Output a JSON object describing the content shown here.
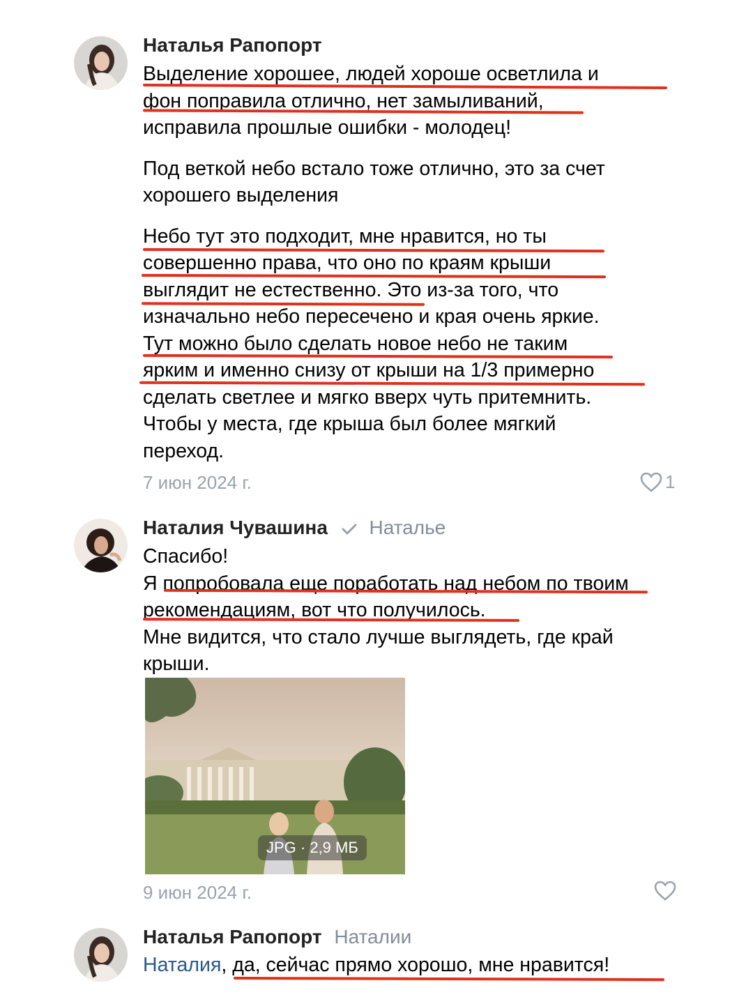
{
  "comments": [
    {
      "author": "Наталья Рапопорт",
      "lines": [
        "Выделение хорошее, людей хороше осветлила и",
        "фон поправила отлично, нет замыливаний,",
        "исправила прошлые ошибки - молодец!"
      ],
      "paragraph2": [
        "Под веткой небо встало тоже отлично, это за счет",
        "хорошего выделения"
      ],
      "paragraph3": [
        "Небо тут это подходит, мне нравится, но ты",
        "совершенно права, что оно по краям крыши",
        "выглядит не естественно. Это из-за того, что",
        "изначально небо пересечено и края очень яркие.",
        "Тут можно было сделать новое небо не таким",
        "ярким и именно снизу от крыши на 1/3 примерно",
        "сделать светлее и мягко вверх чуть притемнить.",
        "Чтобы у места, где крыша был более мягкий",
        "переход."
      ],
      "date": "7 июн 2024 г.",
      "likes": "1"
    },
    {
      "author": "Наталия Чувашина",
      "reply_to": "Наталье",
      "lines": [
        "Спасибо!",
        "Я попробовала еще поработать над небом по твоим",
        "рекомендациям, вот что получилось.",
        "Мне видится, что стало лучше выглядеть, где край",
        "крыши."
      ],
      "attachment": {
        "label": "JPG · 2,9 МБ"
      },
      "date": "9 июн 2024 г."
    },
    {
      "author": "Наталья Рапопорт",
      "reply_to": "Наталии",
      "mention": "Наталия",
      "text": ", да, сейчас прямо хорошо, мне нравится!"
    }
  ],
  "colors": {
    "highlight_underline": "#e0301e",
    "mention": "#2a5885",
    "meta": "#99a2ad"
  },
  "icons": [
    "heart-icon",
    "verified-check-icon"
  ]
}
